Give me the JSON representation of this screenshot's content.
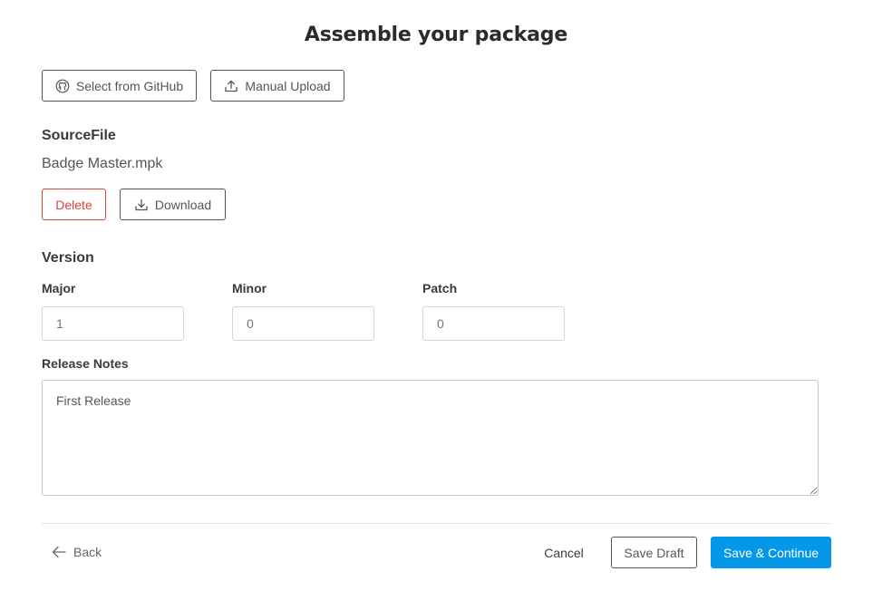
{
  "page": {
    "title": "Assemble your package"
  },
  "source_buttons": {
    "github_label": "Select from GitHub",
    "github_icon": "github-icon",
    "upload_label": "Manual Upload",
    "upload_icon": "upload-icon"
  },
  "source_file": {
    "heading": "SourceFile",
    "file_name": "Badge Master.mpk",
    "delete_label": "Delete",
    "download_label": "Download",
    "download_icon": "download-icon"
  },
  "version": {
    "heading": "Version",
    "major_label": "Major",
    "major_placeholder": "1",
    "minor_label": "Minor",
    "minor_placeholder": "0",
    "patch_label": "Patch",
    "patch_placeholder": "0"
  },
  "release_notes": {
    "label": "Release Notes",
    "value": "First Release"
  },
  "footer": {
    "back_label": "Back",
    "back_icon": "arrow-left-icon",
    "cancel_label": "Cancel",
    "save_draft_label": "Save Draft",
    "save_continue_label": "Save & Continue"
  },
  "colors": {
    "primary": "#0598e8",
    "danger": "#d64545",
    "text": "#3a3a3a"
  }
}
